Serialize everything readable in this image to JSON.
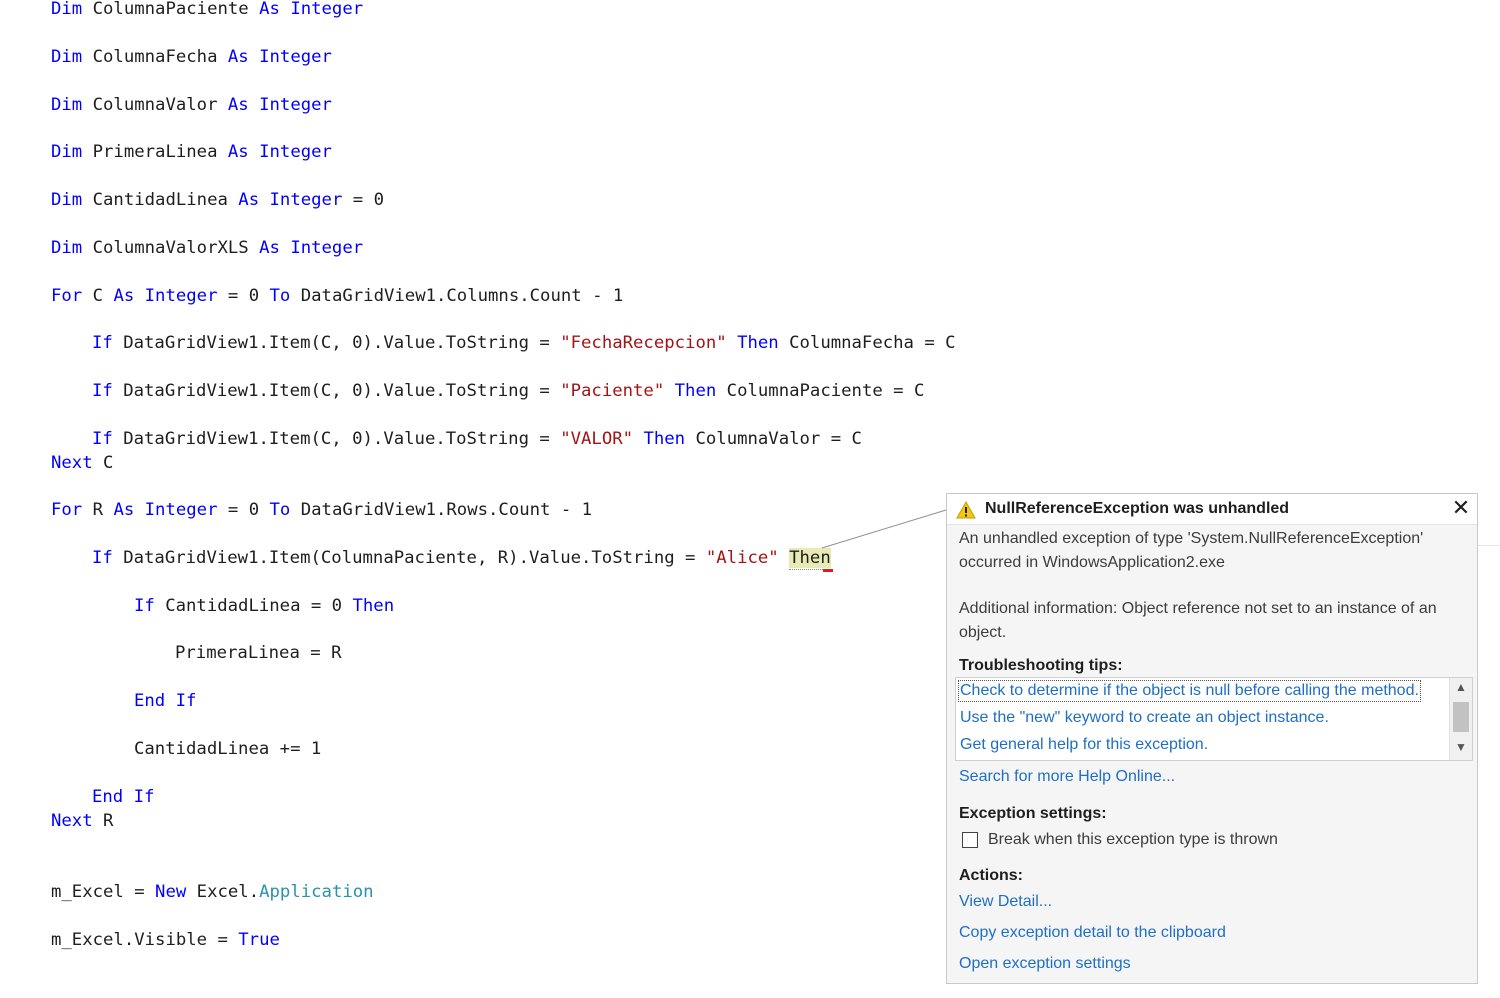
{
  "code": {
    "lines": [
      [
        {
          "t": "Dim",
          "c": "kw"
        },
        {
          "t": " ColumnaPaciente "
        },
        {
          "t": "As",
          "c": "kw"
        },
        {
          "t": " "
        },
        {
          "t": "Integer",
          "c": "kw"
        }
      ],
      [
        {
          "t": "Dim",
          "c": "kw"
        },
        {
          "t": " ColumnaFecha "
        },
        {
          "t": "As",
          "c": "kw"
        },
        {
          "t": " "
        },
        {
          "t": "Integer",
          "c": "kw"
        }
      ],
      [
        {
          "t": "Dim",
          "c": "kw"
        },
        {
          "t": " ColumnaValor "
        },
        {
          "t": "As",
          "c": "kw"
        },
        {
          "t": " "
        },
        {
          "t": "Integer",
          "c": "kw"
        }
      ],
      [
        {
          "t": "Dim",
          "c": "kw"
        },
        {
          "t": " PrimeraLinea "
        },
        {
          "t": "As",
          "c": "kw"
        },
        {
          "t": " "
        },
        {
          "t": "Integer",
          "c": "kw"
        }
      ],
      [
        {
          "t": "Dim",
          "c": "kw"
        },
        {
          "t": " CantidadLinea "
        },
        {
          "t": "As",
          "c": "kw"
        },
        {
          "t": " "
        },
        {
          "t": "Integer",
          "c": "kw"
        },
        {
          "t": " = 0"
        }
      ],
      [
        {
          "t": "Dim",
          "c": "kw"
        },
        {
          "t": " ColumnaValorXLS "
        },
        {
          "t": "As",
          "c": "kw"
        },
        {
          "t": " "
        },
        {
          "t": "Integer",
          "c": "kw"
        }
      ],
      [
        {
          "t": "For",
          "c": "kw"
        },
        {
          "t": " C "
        },
        {
          "t": "As",
          "c": "kw"
        },
        {
          "t": " "
        },
        {
          "t": "Integer",
          "c": "kw"
        },
        {
          "t": " = 0 "
        },
        {
          "t": "To",
          "c": "kw"
        },
        {
          "t": " DataGridView1.Columns.Count - 1"
        }
      ],
      [
        {
          "t": "If",
          "c": "kw"
        },
        {
          "t": " DataGridView1.Item(C, 0).Value.ToString = "
        },
        {
          "t": "\"FechaRecepcion\"",
          "c": "str"
        },
        {
          "t": " "
        },
        {
          "t": "Then",
          "c": "kw"
        },
        {
          "t": " ColumnaFecha = C"
        }
      ],
      [
        {
          "t": "If",
          "c": "kw"
        },
        {
          "t": " DataGridView1.Item(C, 0).Value.ToString = "
        },
        {
          "t": "\"Paciente\"",
          "c": "str"
        },
        {
          "t": " "
        },
        {
          "t": "Then",
          "c": "kw"
        },
        {
          "t": " ColumnaPaciente = C"
        }
      ],
      [
        {
          "t": "If",
          "c": "kw"
        },
        {
          "t": " DataGridView1.Item(C, 0).Value.ToString = "
        },
        {
          "t": "\"VALOR\"",
          "c": "str"
        },
        {
          "t": " "
        },
        {
          "t": "Then",
          "c": "kw"
        },
        {
          "t": " ColumnaValor = C"
        }
      ],
      [
        {
          "t": "Next",
          "c": "kw"
        },
        {
          "t": " C"
        }
      ],
      [
        {
          "t": "For",
          "c": "kw"
        },
        {
          "t": " R "
        },
        {
          "t": "As",
          "c": "kw"
        },
        {
          "t": " "
        },
        {
          "t": "Integer",
          "c": "kw"
        },
        {
          "t": " = 0 "
        },
        {
          "t": "To",
          "c": "kw"
        },
        {
          "t": " DataGridView1.Rows.Count - 1"
        }
      ],
      [
        {
          "t": "If",
          "c": "kw"
        },
        {
          "t": " DataGridView1.Item(ColumnaPaciente, R).Value.ToString = "
        },
        {
          "t": "\"Alice\"",
          "c": "str"
        },
        {
          "t": " "
        },
        {
          "t": "Then",
          "c": "hl"
        }
      ],
      [
        {
          "t": "If",
          "c": "kw"
        },
        {
          "t": " CantidadLinea = 0 "
        },
        {
          "t": "Then",
          "c": "kw"
        }
      ],
      [
        {
          "t": "PrimeraLinea = R"
        }
      ],
      [
        {
          "t": "End",
          "c": "kw"
        },
        {
          "t": " "
        },
        {
          "t": "If",
          "c": "kw"
        }
      ],
      [
        {
          "t": "CantidadLinea += 1"
        }
      ],
      [
        {
          "t": "End",
          "c": "kw"
        },
        {
          "t": " "
        },
        {
          "t": "If",
          "c": "kw"
        }
      ],
      [
        {
          "t": "Next",
          "c": "kw"
        },
        {
          "t": " R"
        }
      ],
      [
        {
          "t": "m_Excel = "
        },
        {
          "t": "New",
          "c": "kw"
        },
        {
          "t": " Excel."
        },
        {
          "t": "Application",
          "c": "ty"
        }
      ],
      [
        {
          "t": "m_Excel.Visible = "
        },
        {
          "t": "True",
          "c": "kw"
        }
      ]
    ]
  },
  "dialog": {
    "title": "NullReferenceException was unhandled",
    "close_glyph": "✕",
    "description": "An unhandled exception of type 'System.NullReferenceException' occurred in WindowsApplication2.exe",
    "additional_info": "Additional information: Object reference not set to an instance of an object.",
    "tips_heading": "Troubleshooting tips:",
    "tips": [
      "Check to determine if the object is null before calling the method.",
      "Use the \"new\" keyword to create an object instance.",
      "Get general help for this exception."
    ],
    "search_link": "Search for more Help Online...",
    "settings_heading": "Exception settings:",
    "break_checkbox_label": "Break when this exception type is thrown",
    "break_checked": false,
    "actions_heading": "Actions:",
    "actions": [
      "View Detail...",
      "Copy exception detail to the clipboard",
      "Open exception settings"
    ]
  },
  "icons": {
    "warning": "warning-icon",
    "close": "close-icon",
    "scroll_up": "chevron-up-icon",
    "scroll_down": "chevron-down-icon"
  },
  "colors": {
    "keyword": "#0000ff",
    "string": "#a31515",
    "type": "#2b91af",
    "link": "#1e6fc4",
    "highlight": "#e8ecb4",
    "warning": "#f2c811"
  }
}
